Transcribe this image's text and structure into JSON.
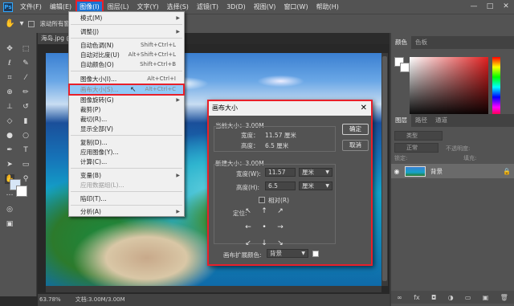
{
  "menubar": {
    "logo": "Ps",
    "items": [
      "文件(F)",
      "编辑(E)",
      "图像(I)",
      "图层(L)",
      "文字(Y)",
      "选择(S)",
      "滤镜(T)",
      "3D(D)",
      "视图(V)",
      "窗口(W)",
      "帮助(H)"
    ],
    "window_controls": [
      "—",
      "□",
      "✕"
    ]
  },
  "options_bar": {
    "checkbox_label": "滚动所有窗"
  },
  "document": {
    "tab_title": "海岛.jpg @",
    "zoom": "63.78%",
    "doc_info": "文档:3.00M/3.00M"
  },
  "image_menu": {
    "items": [
      {
        "label": "模式(M)",
        "shortcut": "",
        "submenu": true,
        "disabled": false
      },
      {
        "label": "调整(J)",
        "shortcut": "",
        "submenu": true,
        "disabled": false
      },
      {
        "label": "自动色调(N)",
        "shortcut": "Shift+Ctrl+L",
        "submenu": false,
        "disabled": false
      },
      {
        "label": "自动对比度(U)",
        "shortcut": "Alt+Shift+Ctrl+L",
        "submenu": false,
        "disabled": false
      },
      {
        "label": "自动颜色(O)",
        "shortcut": "Shift+Ctrl+B",
        "submenu": false,
        "disabled": false
      },
      {
        "label": "图像大小(I)...",
        "shortcut": "Alt+Ctrl+I",
        "submenu": false,
        "disabled": false
      },
      {
        "label": "画布大小(S)...",
        "shortcut": "Alt+Ctrl+C",
        "submenu": false,
        "disabled": false,
        "highlighted": true
      },
      {
        "label": "图像旋转(G)",
        "shortcut": "",
        "submenu": true,
        "disabled": false
      },
      {
        "label": "裁剪(P)",
        "shortcut": "",
        "submenu": false,
        "disabled": false
      },
      {
        "label": "裁切(R)...",
        "shortcut": "",
        "submenu": false,
        "disabled": false
      },
      {
        "label": "显示全部(V)",
        "shortcut": "",
        "submenu": false,
        "disabled": false
      },
      {
        "label": "复制(D)...",
        "shortcut": "",
        "submenu": false,
        "disabled": false
      },
      {
        "label": "应用图像(Y)...",
        "shortcut": "",
        "submenu": false,
        "disabled": false
      },
      {
        "label": "计算(C)...",
        "shortcut": "",
        "submenu": false,
        "disabled": false
      },
      {
        "label": "变量(B)",
        "shortcut": "",
        "submenu": true,
        "disabled": false
      },
      {
        "label": "应用数据组(L)...",
        "shortcut": "",
        "submenu": false,
        "disabled": true
      },
      {
        "label": "陷印(T)...",
        "shortcut": "",
        "submenu": false,
        "disabled": false
      },
      {
        "label": "分析(A)",
        "shortcut": "",
        "submenu": true,
        "disabled": false
      }
    ]
  },
  "canvas_dialog": {
    "title": "画布大小",
    "current_label": "当前大小：3.00M",
    "current_width_label": "宽度：",
    "current_width_value": "11.57 厘米",
    "current_height_label": "高度：",
    "current_height_value": "6.5 厘米",
    "new_label": "新建大小：3.00M",
    "new_width_label": "宽度(W):",
    "new_width_value": "11.57",
    "new_width_unit": "厘米",
    "new_height_label": "高度(H):",
    "new_height_value": "6.5",
    "new_height_unit": "厘米",
    "relative_label": "相对(R)",
    "anchor_label": "定位:",
    "extension_label": "画布扩展颜色:",
    "extension_value": "背景",
    "ok_button": "确定",
    "cancel_button": "取消"
  },
  "color_panel": {
    "tabs": [
      "颜色",
      "色板"
    ]
  },
  "layers_panel": {
    "tabs": [
      "图层",
      "路径",
      "通道"
    ],
    "filter_placeholder": "类型",
    "blend_mode": "正常",
    "opacity_label": "不透明度:",
    "lock_label": "锁定:",
    "fill_label": "填充:",
    "layer_name": "背景",
    "footer_icons": [
      "∞",
      "fx",
      "◘",
      "◑",
      "▭",
      "▣",
      "🗑"
    ]
  },
  "colors": {
    "menu_highlight": "#1b73d3",
    "annotation_red": "#e8202a",
    "panel_bg": "#535353"
  }
}
